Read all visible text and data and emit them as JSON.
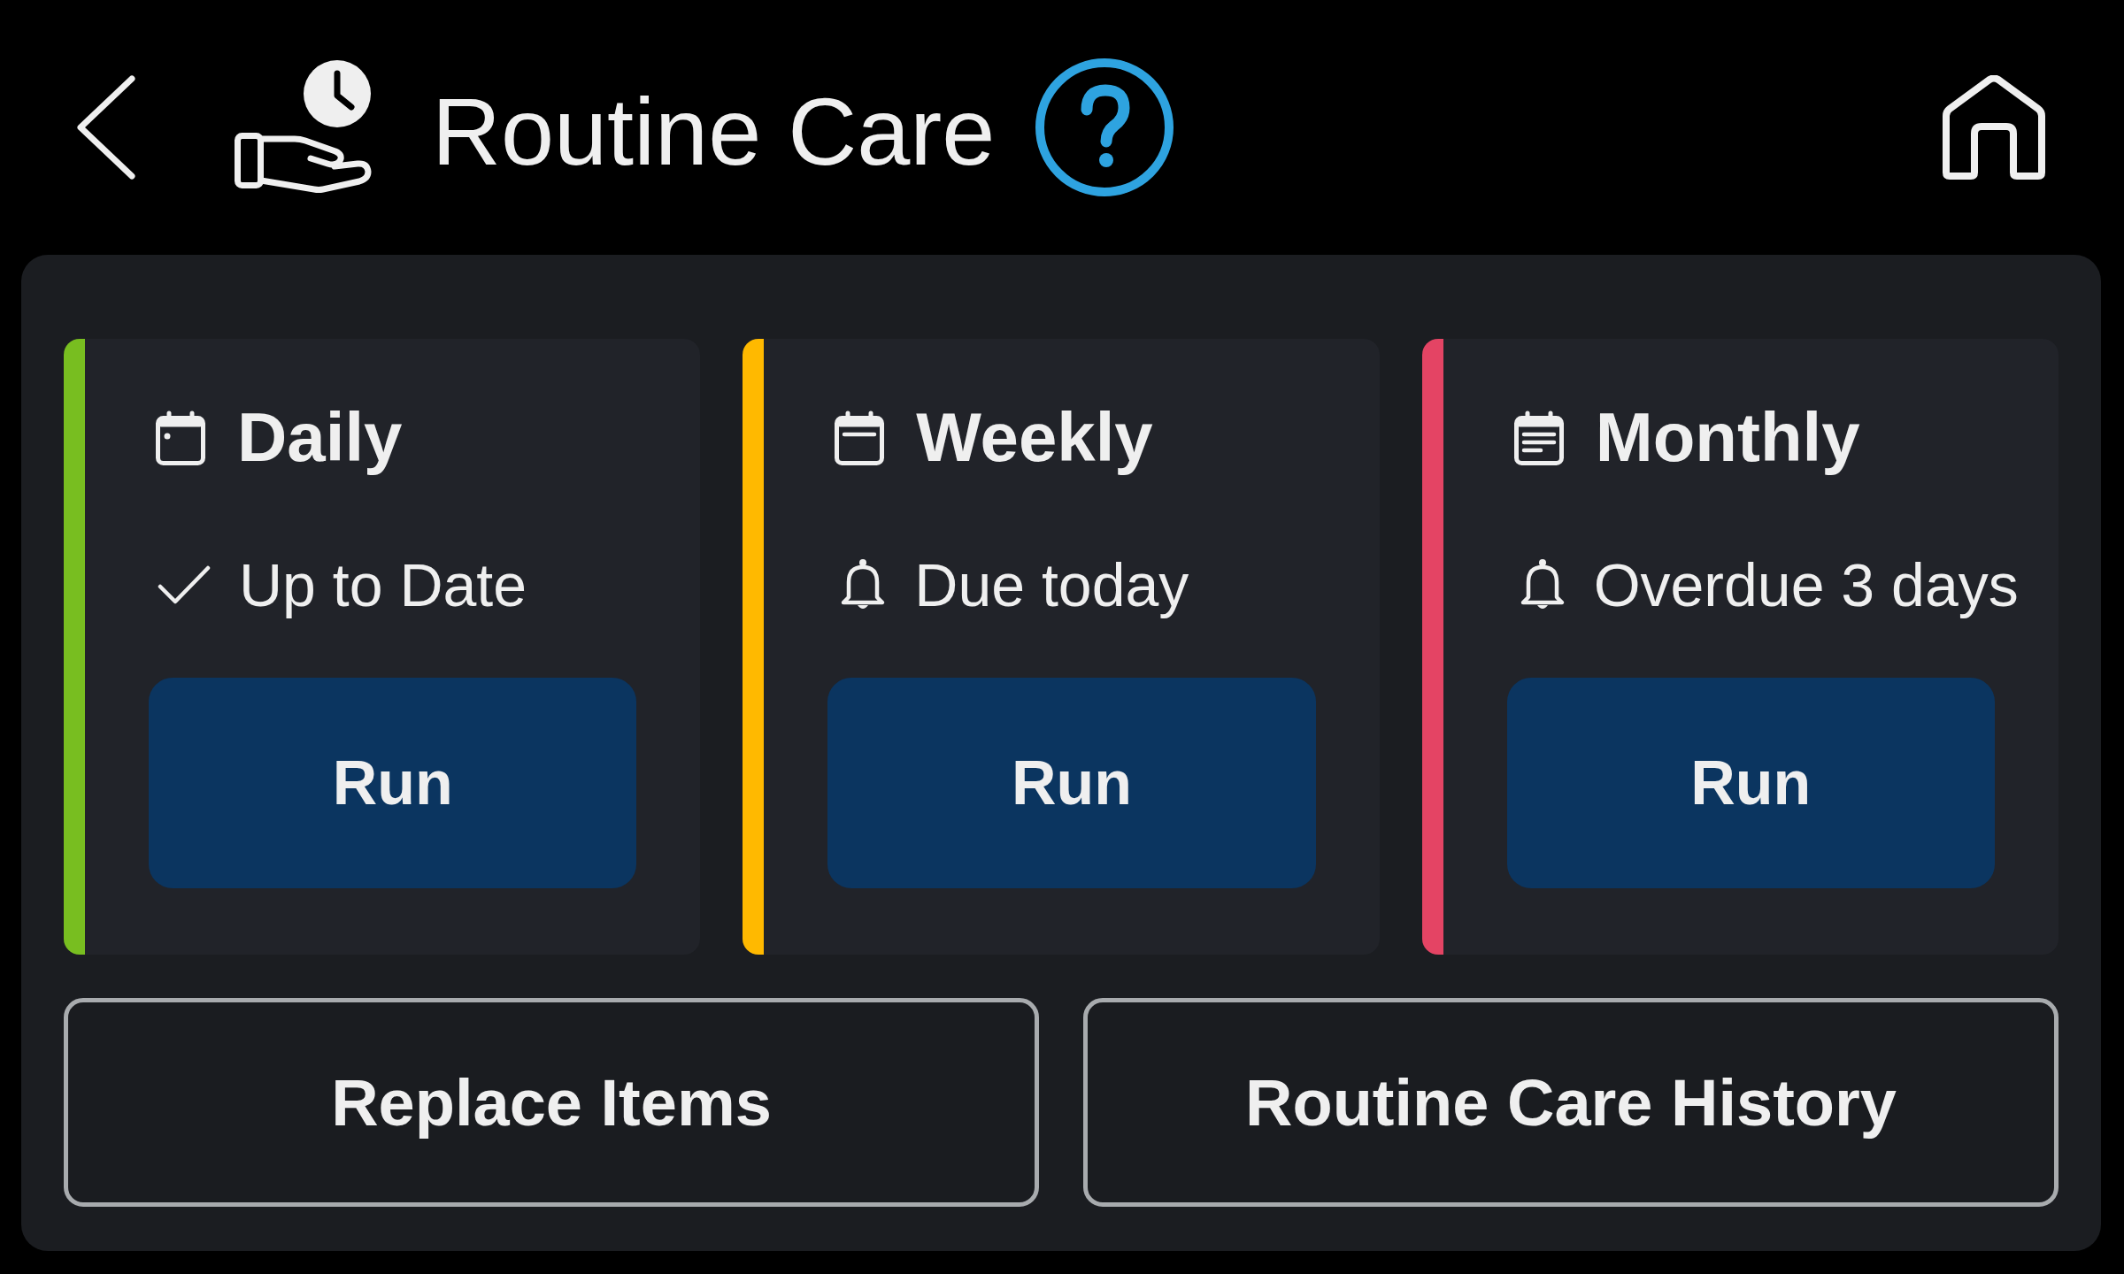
{
  "header": {
    "title": "Routine Care"
  },
  "schedules": [
    {
      "kind": "daily",
      "title": "Daily",
      "color": "#78be20",
      "status": {
        "kind": "done",
        "text": "Up to Date"
      },
      "button": "Run"
    },
    {
      "kind": "weekly",
      "title": "Weekly",
      "color": "#ffb900",
      "status": {
        "kind": "alert",
        "text": "Due today"
      },
      "button": "Run"
    },
    {
      "kind": "monthly",
      "title": "Monthly",
      "color": "#e44464",
      "status": {
        "kind": "alert",
        "text": "Overdue 3 days"
      },
      "button": "Run"
    }
  ],
  "actions": [
    {
      "label": "Replace Items"
    },
    {
      "label": "Routine Care History"
    }
  ]
}
